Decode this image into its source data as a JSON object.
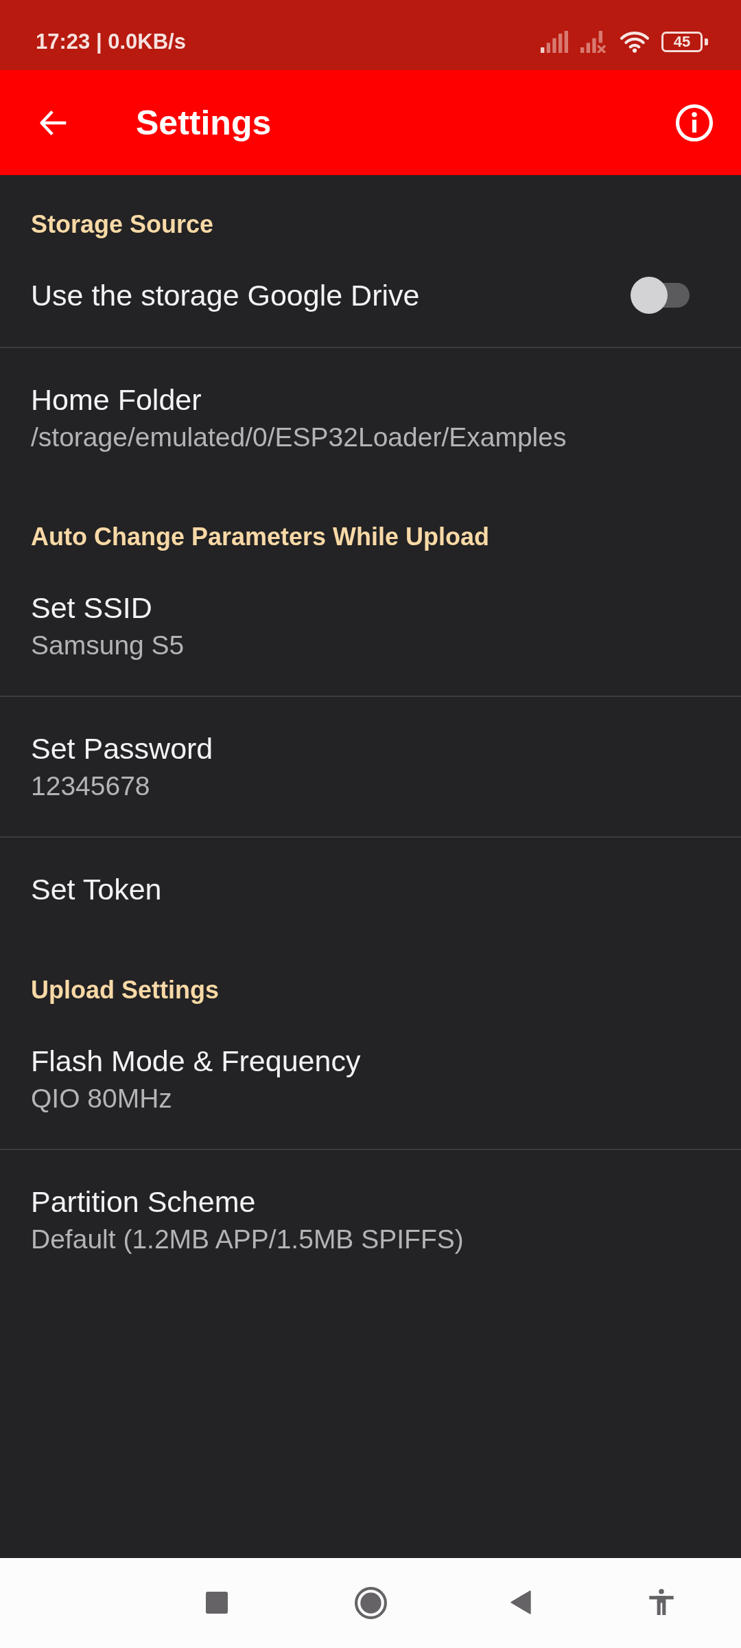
{
  "status_bar": {
    "clock": "17:23 | 0.0KB/s",
    "battery": "45"
  },
  "app_bar": {
    "title": "Settings"
  },
  "sections": [
    {
      "header": "Storage Source",
      "items": [
        {
          "kind": "switch",
          "title": "Use the storage Google Drive",
          "on": false
        },
        {
          "kind": "text",
          "title": "Home Folder",
          "summary": "/storage/emulated/0/ESP32Loader/Examples"
        }
      ]
    },
    {
      "header": "Auto Change Parameters While Upload",
      "items": [
        {
          "kind": "text",
          "title": "Set SSID",
          "summary": "Samsung S5"
        },
        {
          "kind": "text",
          "title": "Set Password",
          "summary": "12345678"
        },
        {
          "kind": "text",
          "title": "Set Token"
        }
      ]
    },
    {
      "header": "Upload Settings",
      "items": [
        {
          "kind": "text",
          "title": "Flash Mode & Frequency",
          "summary": "QIO 80MHz"
        },
        {
          "kind": "text",
          "title": "Partition Scheme",
          "summary": "Default (1.2MB APP/1.5MB SPIFFS)"
        }
      ]
    }
  ]
}
